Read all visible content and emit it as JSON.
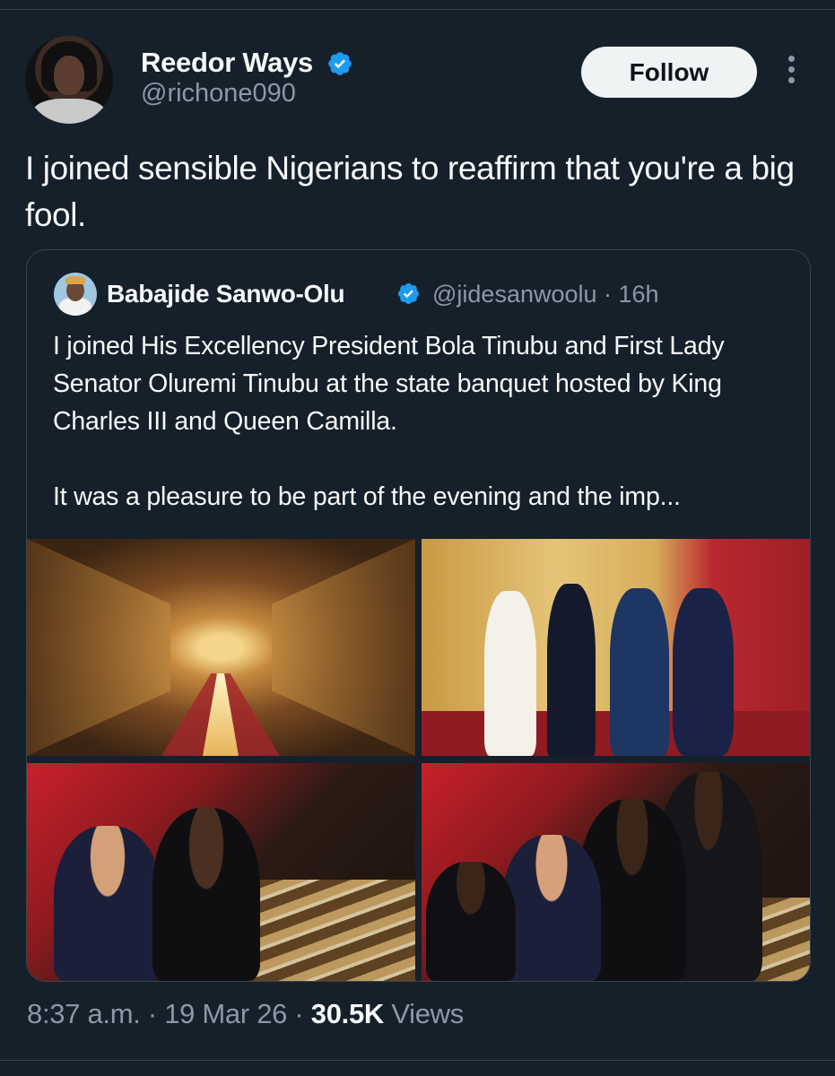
{
  "tweet": {
    "author": {
      "name": "Reedor Ways",
      "handle": "@richone090"
    },
    "follow_label": "Follow",
    "text": "I joined sensible Nigerians to reaffirm that you're a big fool.",
    "timestamp": "8:37 a.m.",
    "date": "19 Mar 26",
    "views_count": "30.5K",
    "views_label": "Views",
    "separator": " · "
  },
  "quoted": {
    "author": {
      "name": "Babajide Sanwo-Olu",
      "handle": "@jidesanwoolu",
      "age": "16h"
    },
    "text": "I joined His Excellency President Bola Tinubu and First Lady Senator Oluremi Tinubu at the state banquet hosted by King Charles III and Queen Camilla.\n\nIt was a pleasure to be part of the evening and the imp...",
    "images": [
      "banquet-hall-photo",
      "royal-reception-photo",
      "dinner-guests-photo-1",
      "dinner-guests-photo-2"
    ]
  },
  "colors": {
    "background": "#15202b",
    "verified": "#1d9bf0",
    "muted": "#8b98a5",
    "text": "#f7f9f9"
  },
  "icons": [
    "verified-badge-icon",
    "more-options-icon"
  ]
}
